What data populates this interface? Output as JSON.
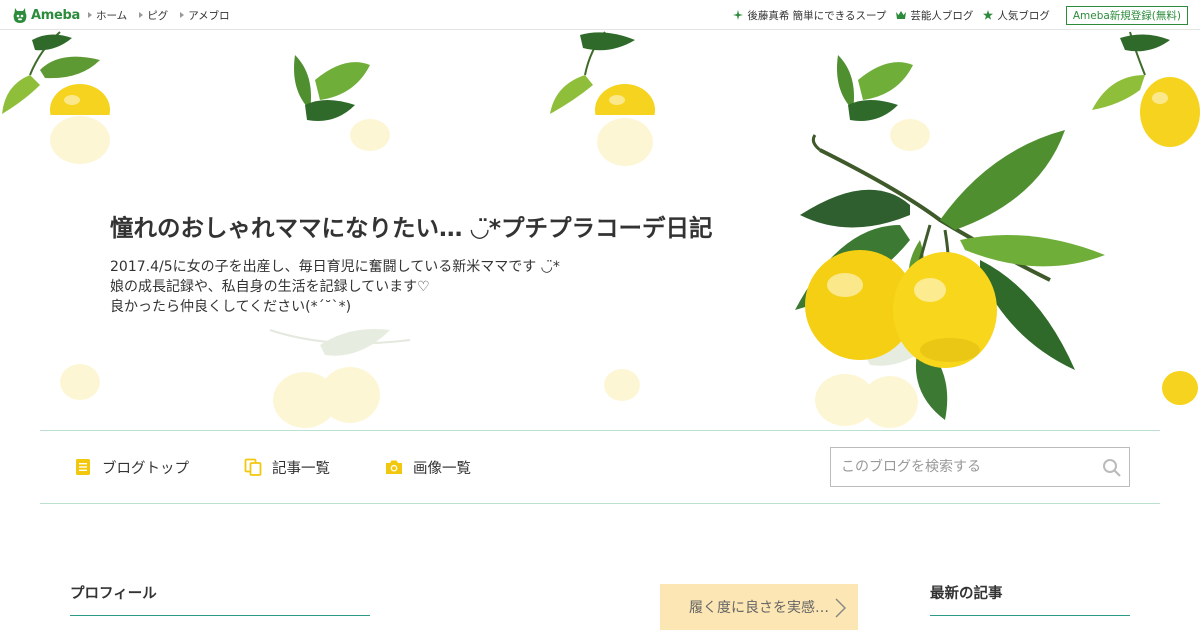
{
  "topbar": {
    "logo_text": "Ameba",
    "nav": [
      {
        "label": "ホーム"
      },
      {
        "label": "ピグ"
      },
      {
        "label": "アメブロ"
      }
    ],
    "links": [
      {
        "label": "後藤真希 簡単にできるスープ",
        "icon": "sparkle-icon"
      },
      {
        "label": "芸能人ブログ",
        "icon": "crown-icon"
      },
      {
        "label": "人気ブログ",
        "icon": "star-icon"
      }
    ],
    "register_label": "Ameba新規登録(無料)"
  },
  "header": {
    "title": "憧れのおしゃれママになりたい… ◡̈*プチプラコーデ日記",
    "description": [
      "2017.4/5に女の子を出産し、毎日育児に奮闘している新米ママです ◡̈*",
      "娘の成長記録や、私自身の生活を記録しています♡",
      "良かったら仲良くしてください(*´˘`*)"
    ]
  },
  "navbar": {
    "links": [
      {
        "label": "ブログトップ",
        "icon": "document-icon"
      },
      {
        "label": "記事一覧",
        "icon": "copy-icon"
      },
      {
        "label": "画像一覧",
        "icon": "camera-icon"
      }
    ],
    "search_placeholder": "このブログを検索する"
  },
  "content": {
    "profile_heading": "プロフィール",
    "latest_heading": "最新の記事",
    "promo_text": "履く度に良さを実感…"
  },
  "colors": {
    "brand_green": "#2d8c3c",
    "divider_teal": "#2c9a86",
    "lemon_yellow": "#f5d31e",
    "promo_bg": "#fce6b4"
  }
}
